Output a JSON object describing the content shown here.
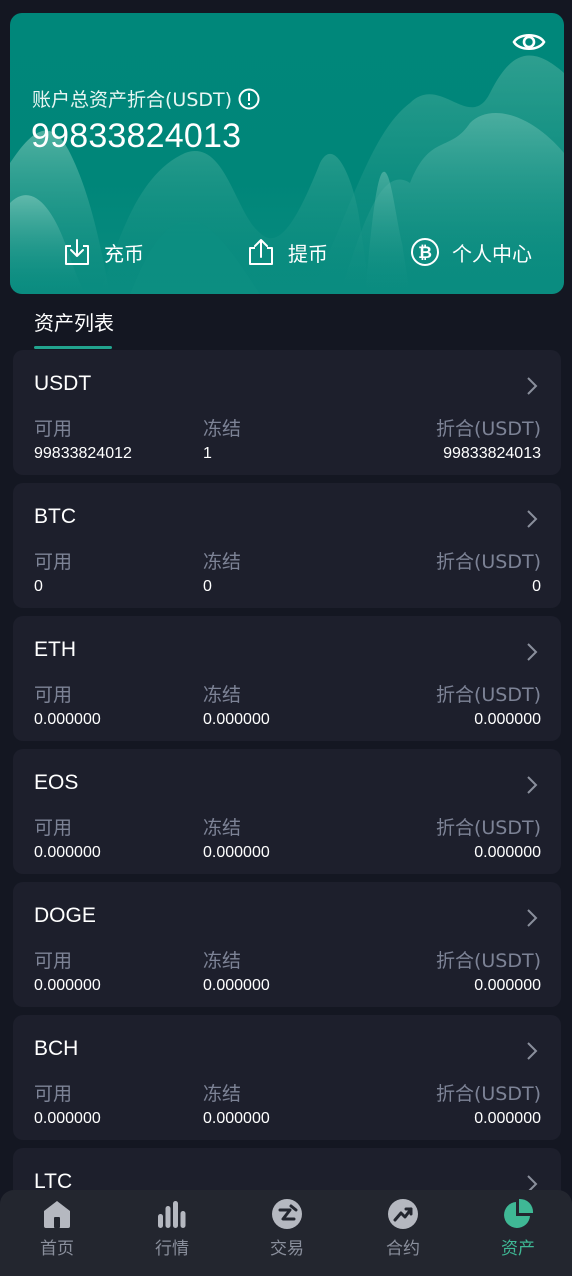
{
  "hero": {
    "total_label": "账户总资产折合(USDT)",
    "total_value": "99833824013",
    "actions": {
      "deposit": "充币",
      "withdraw": "提币",
      "personal_center": "个人中心"
    }
  },
  "section": {
    "tab_label": "资产列表"
  },
  "columns": {
    "available": "可用",
    "frozen": "冻结",
    "equivalent": "折合(USDT)"
  },
  "assets": [
    {
      "name": "USDT",
      "available": "99833824012",
      "frozen": "1",
      "equivalent": "99833824013"
    },
    {
      "name": "BTC",
      "available": "0",
      "frozen": "0",
      "equivalent": "0"
    },
    {
      "name": "ETH",
      "available": "0.000000",
      "frozen": "0.000000",
      "equivalent": "0.000000"
    },
    {
      "name": "EOS",
      "available": "0.000000",
      "frozen": "0.000000",
      "equivalent": "0.000000"
    },
    {
      "name": "DOGE",
      "available": "0.000000",
      "frozen": "0.000000",
      "equivalent": "0.000000"
    },
    {
      "name": "BCH",
      "available": "0.000000",
      "frozen": "0.000000",
      "equivalent": "0.000000"
    },
    {
      "name": "LTC"
    }
  ],
  "nav": {
    "items": [
      {
        "label": "首页",
        "icon": "home-icon"
      },
      {
        "label": "行情",
        "icon": "market-chart-icon"
      },
      {
        "label": "交易",
        "icon": "trade-icon"
      },
      {
        "label": "合约",
        "icon": "contract-icon"
      },
      {
        "label": "资产",
        "icon": "assets-pie-icon"
      }
    ],
    "active_index": 4
  },
  "colors": {
    "accent": "#22a48f",
    "hero_bg": "#00877a",
    "page_bg": "#141722",
    "card_bg": "#1d1f2c",
    "nav_active": "#3fb895"
  }
}
